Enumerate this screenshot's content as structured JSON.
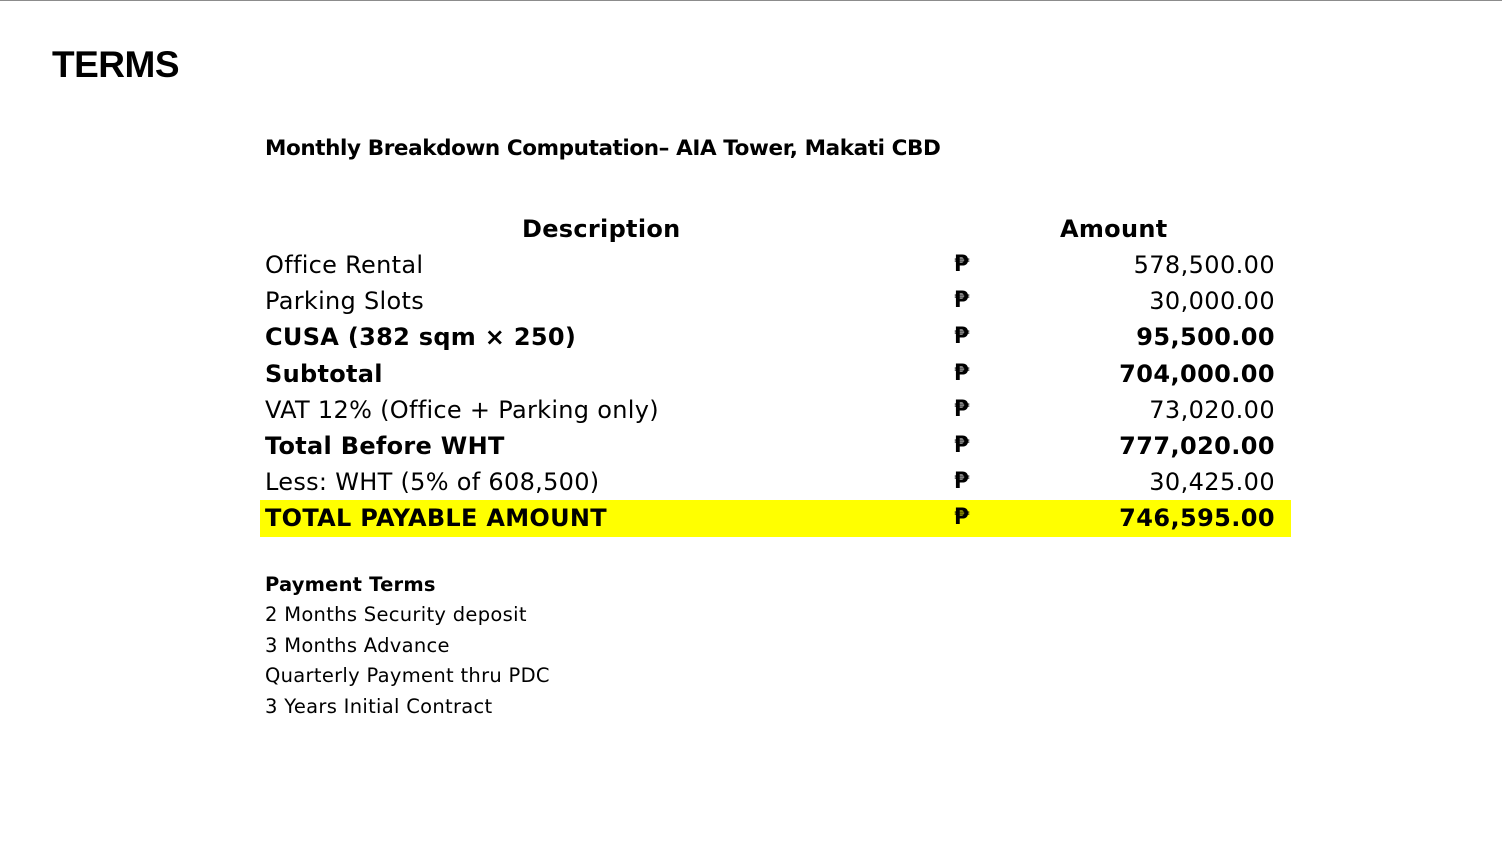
{
  "page": {
    "title": "TERMS",
    "subtitle": "Monthly Breakdown Computation– AIA Tower, Makati CBD"
  },
  "table": {
    "headers": {
      "description": "Description",
      "amount": "Amount"
    },
    "currency_symbol": "₱",
    "rows": [
      {
        "description": "Office Rental",
        "amount": "578,500.00",
        "bold": false,
        "highlight": false
      },
      {
        "description": "Parking Slots",
        "amount": "30,000.00",
        "bold": false,
        "highlight": false
      },
      {
        "description": "CUSA (382 sqm × 250)",
        "amount": "95,500.00",
        "bold": true,
        "highlight": false
      },
      {
        "description": "Subtotal",
        "amount": "704,000.00",
        "bold": true,
        "highlight": false
      },
      {
        "description": "VAT 12% (Office + Parking only)",
        "amount": "73,020.00",
        "bold": false,
        "highlight": false
      },
      {
        "description": "Total Before WHT",
        "amount": "777,020.00",
        "bold": true,
        "highlight": false
      },
      {
        "description": "Less: WHT (5% of 608,500)",
        "amount": "30,425.00",
        "bold": false,
        "highlight": false
      },
      {
        "description": "TOTAL PAYABLE AMOUNT",
        "amount": "746,595.00",
        "bold": true,
        "highlight": true
      }
    ],
    "highlight_color": "#ffff00"
  },
  "payment_terms": {
    "heading": "Payment Terms",
    "items": [
      "2 Months Security deposit",
      "3 Months Advance",
      "Quarterly Payment thru PDC",
      "3 Years Initial Contract"
    ]
  }
}
